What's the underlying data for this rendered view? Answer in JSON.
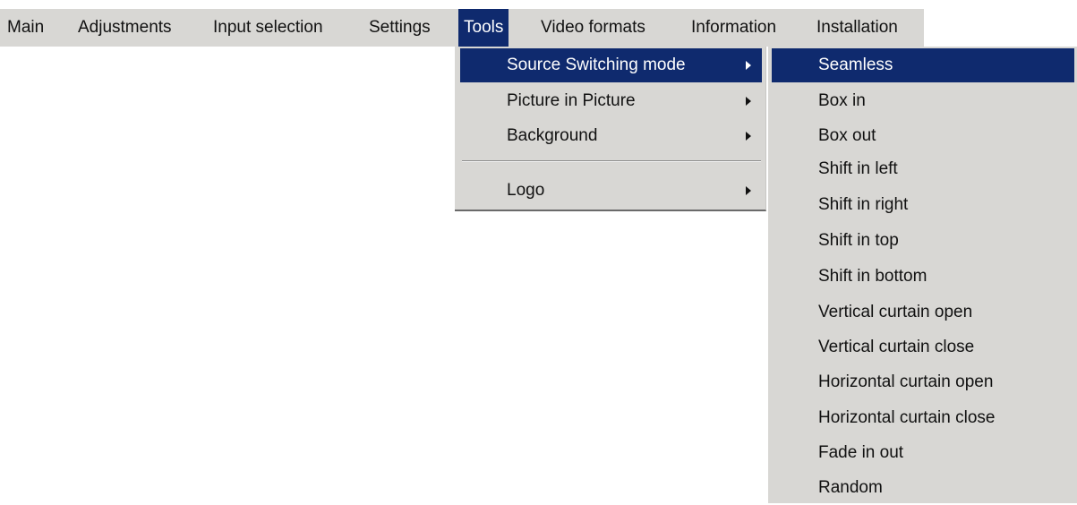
{
  "menubar": {
    "items": [
      {
        "label": "Main"
      },
      {
        "label": "Adjustments"
      },
      {
        "label": "Input selection"
      },
      {
        "label": "Settings"
      },
      {
        "label": "Tools",
        "active": true
      },
      {
        "label": "Video formats"
      },
      {
        "label": "Information"
      },
      {
        "label": "Installation"
      }
    ]
  },
  "tools_menu": {
    "items": [
      {
        "label": "Source Switching mode",
        "has_submenu": true,
        "active": true
      },
      {
        "label": "Picture in Picture",
        "has_submenu": true
      },
      {
        "label": "Background",
        "has_submenu": true
      },
      {
        "label": "Logo",
        "has_submenu": true
      }
    ]
  },
  "source_switching_submenu": {
    "items": [
      {
        "label": "Seamless",
        "active": true
      },
      {
        "label": "Box in"
      },
      {
        "label": "Box out"
      },
      {
        "label": "Shift in left"
      },
      {
        "label": "Shift in right"
      },
      {
        "label": "Shift in top"
      },
      {
        "label": "Shift in bottom"
      },
      {
        "label": "Vertical curtain open"
      },
      {
        "label": "Vertical curtain close"
      },
      {
        "label": "Horizontal curtain open"
      },
      {
        "label": "Horizontal curtain close"
      },
      {
        "label": "Fade in out"
      },
      {
        "label": "Random"
      }
    ]
  },
  "colors": {
    "menu_background": "#d8d7d4",
    "highlight_background": "#0f2a6e",
    "highlight_text": "#ffffff",
    "text": "#111111"
  },
  "icons": {
    "submenu_arrow": "submenu-arrow-icon"
  }
}
